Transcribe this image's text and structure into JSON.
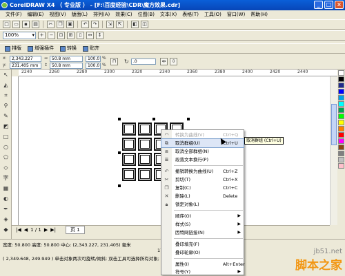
{
  "window": {
    "title": "CorelDRAW X4 （ 专业版 ） - [F:\\百度经验\\CDR\\魔方效果.cdr]"
  },
  "menubar": [
    "文件(F)",
    "编辑(E)",
    "视图(V)",
    "版面(L)",
    "排列(A)",
    "效果(C)",
    "位图(B)",
    "文本(X)",
    "表格(T)",
    "工具(O)",
    "窗口(W)",
    "帮助(H)"
  ],
  "toolbar": {
    "zoom": "100%"
  },
  "pluginbar": {
    "tabs": [
      "排版",
      "增强插件",
      "转换",
      "贴齐"
    ]
  },
  "propbar": {
    "x": "2,343.227 mm",
    "y": "231.405 mm",
    "width": "50.8 mm",
    "height": "50.8 mm",
    "scale_w": "100.0",
    "scale_h": "100.0",
    "pct": "%",
    "rotation": ".0"
  },
  "ruler": {
    "ticks": [
      "2240",
      "2260",
      "2280",
      "2300",
      "2320",
      "2340",
      "2360",
      "2380",
      "2400",
      "2420",
      "2440"
    ]
  },
  "pagebar": {
    "counter": "1 / 1",
    "page_tab": "页 1"
  },
  "status": {
    "line1": "宽度: 50.800 高度: 50.800 中心: (2,343.227, 231.405) 毫米",
    "line2": "( 2,349.648, 249.949 ) 单击对象两次可旋转/倾斜; 双击工具可选择所有对象; 按住",
    "group_label": "17"
  },
  "context_menu": {
    "items": [
      {
        "label": "转换为曲线(V)",
        "shortcut": "Ctrl+Q",
        "disabled": true,
        "icon": "convert-curve-icon"
      },
      {
        "label": "取消群组(U)",
        "shortcut": "Ctrl+U",
        "highlighted": true,
        "icon": "ungroup-icon"
      },
      {
        "label": "取消全部群组(N)",
        "icon": "ungroup-all-icon"
      },
      {
        "label": "段落文本换行(P)",
        "icon": "wrap-text-icon"
      },
      {
        "label": "撤销转换为曲线(U)",
        "shortcut": "Ctrl+Z",
        "icon": "undo-icon"
      },
      {
        "label": "剪切(T)",
        "shortcut": "Ctrl+X",
        "icon": "cut-icon"
      },
      {
        "label": "复制(C)",
        "shortcut": "Ctrl+C",
        "icon": "copy-icon"
      },
      {
        "label": "删除(L)",
        "shortcut": "Delete",
        "icon": "delete-icon"
      },
      {
        "label": "锁定对象(L)",
        "icon": "lock-icon"
      },
      {
        "label": "顺序(O)",
        "submenu": true
      },
      {
        "label": "样式(S)",
        "submenu": true
      },
      {
        "label": "因特网链接(N)",
        "submenu": true
      },
      {
        "label": "叠印填充(F)"
      },
      {
        "label": "叠印轮廓(O)"
      },
      {
        "label": "属性(I)",
        "shortcut": "Alt+Enter"
      },
      {
        "label": "符号(Y)",
        "submenu": true
      }
    ]
  },
  "tooltip": "取消群组 (Ctrl+U)",
  "watermark": {
    "site": "jb51.net",
    "brand": "脚本之家"
  },
  "colors": {
    "title_bar": "#0a5fd8",
    "menu_highlight": "#dde6f6",
    "palette": [
      "#ffffff",
      "#000000",
      "#1f2a8c",
      "#0000ff",
      "#00a2e8",
      "#00ffff",
      "#00a651",
      "#00ff00",
      "#ffff00",
      "#ff7f00",
      "#ff0000",
      "#ff00ff",
      "#8b4513",
      "#808080",
      "#c0c0c0",
      "#ffc0cb"
    ]
  }
}
